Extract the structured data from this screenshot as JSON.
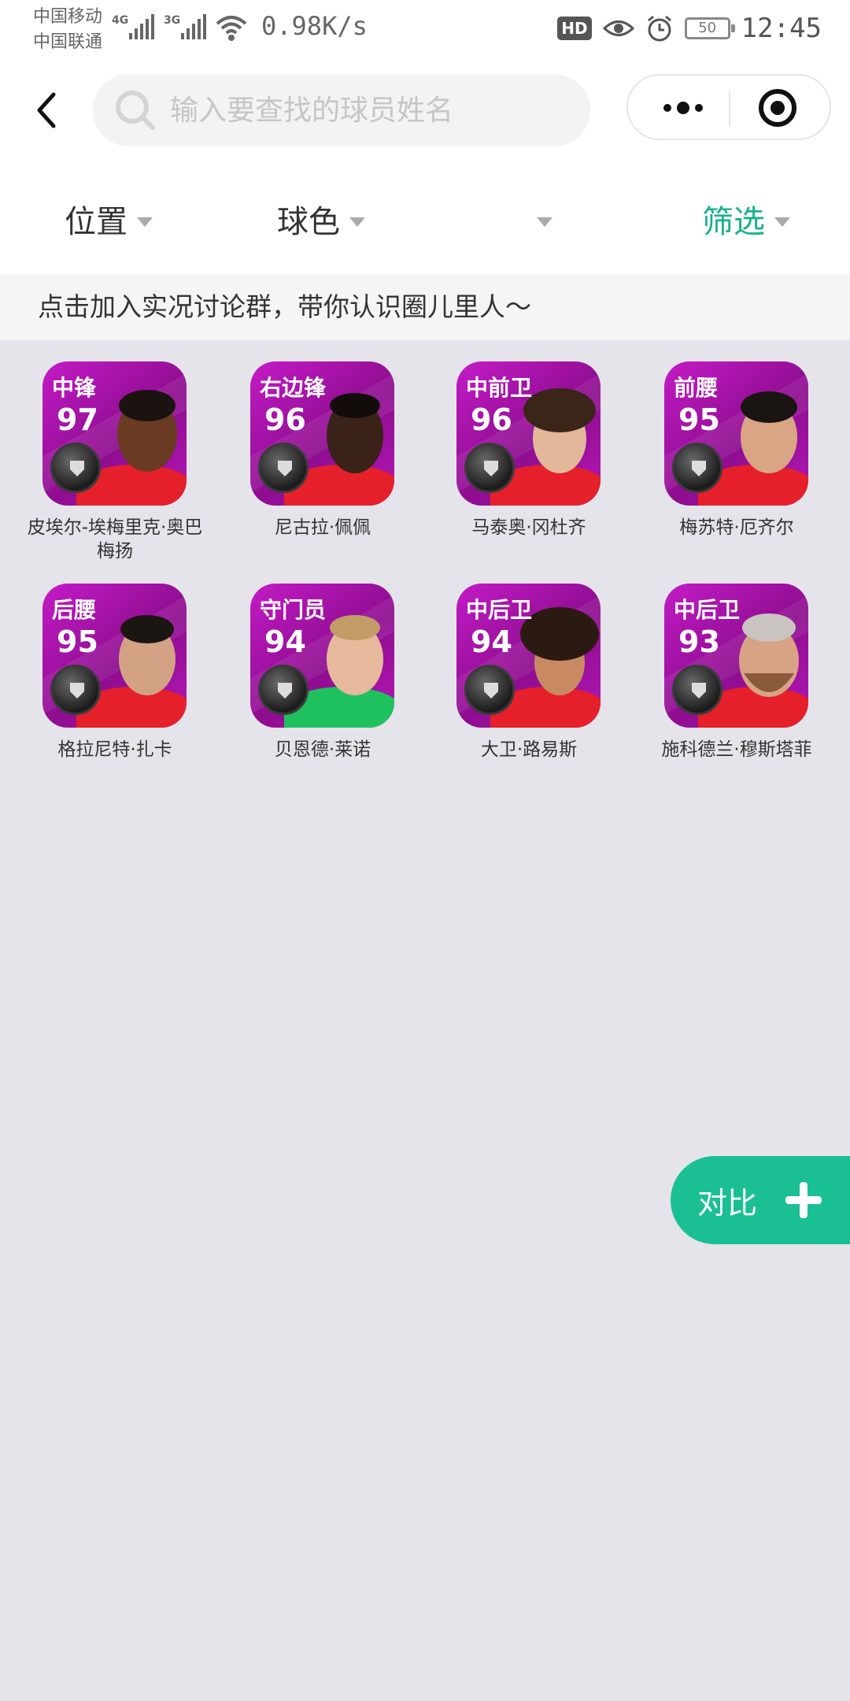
{
  "status_bar": {
    "carrier1": "中国移动",
    "carrier2": "中国联通",
    "net1": "4G",
    "net2": "3G",
    "speed": "0.98K/s",
    "hd": "HD",
    "battery": "50",
    "time": "12:45"
  },
  "search": {
    "placeholder": "输入要查找的球员姓名"
  },
  "filters": {
    "position": "位置",
    "color": "球色",
    "third": "",
    "screen": "筛选"
  },
  "banner": "点击加入实况讨论群，带你认识圈儿里人～",
  "players": [
    {
      "position": "中锋",
      "rating": "97",
      "name": "皮埃尔-埃梅里克·奥巴梅扬"
    },
    {
      "position": "右边锋",
      "rating": "96",
      "name": "尼古拉·佩佩"
    },
    {
      "position": "中前卫",
      "rating": "96",
      "name": "马泰奥·冈杜齐"
    },
    {
      "position": "前腰",
      "rating": "95",
      "name": "梅苏特·厄齐尔"
    },
    {
      "position": "后腰",
      "rating": "95",
      "name": "格拉尼特·扎卡"
    },
    {
      "position": "守门员",
      "rating": "94",
      "name": "贝恩德·莱诺"
    },
    {
      "position": "中后卫",
      "rating": "94",
      "name": "大卫·路易斯"
    },
    {
      "position": "中后卫",
      "rating": "93",
      "name": "施科德兰·穆斯塔菲"
    }
  ],
  "fab": {
    "label": "对比"
  },
  "colors": {
    "accent": "#1abf93",
    "card": "#b418b6",
    "background": "#e5e4ea"
  }
}
